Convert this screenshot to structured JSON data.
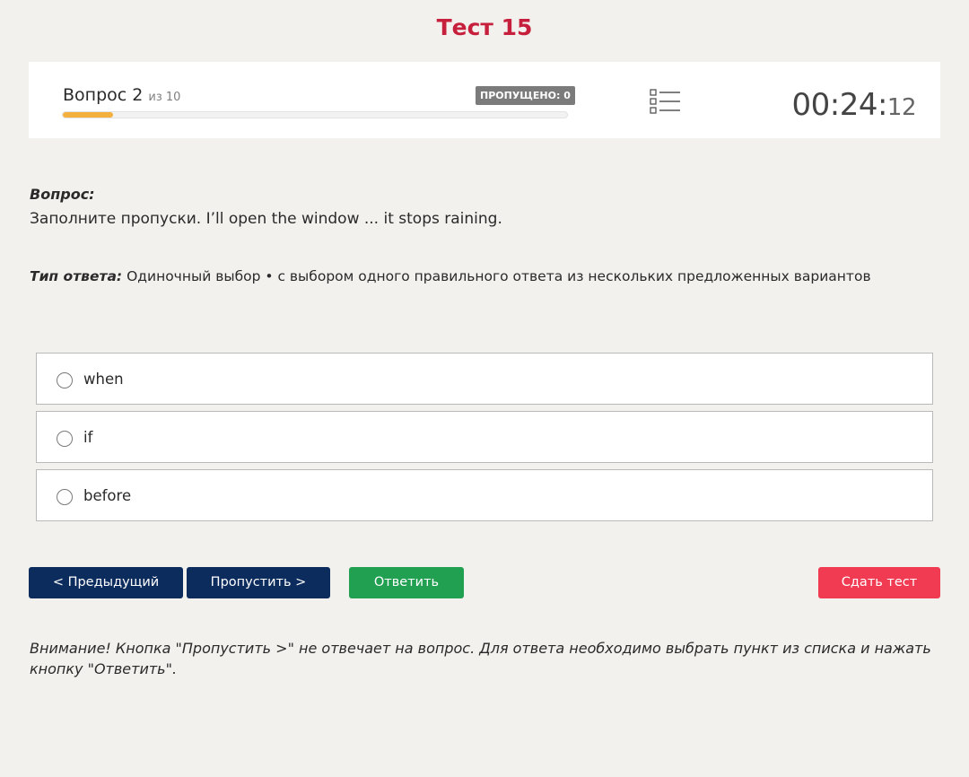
{
  "test": {
    "title": "Тест 15"
  },
  "header": {
    "question_label": "Вопрос 2",
    "question_of": "из 10",
    "skipped_badge": "ПРОПУЩЕНО: 0",
    "progress_fraction": 0.1,
    "progress_color": "#f3b03f",
    "timer_main": "00:24:",
    "timer_seconds": "12",
    "list_icon": "question-list-icon"
  },
  "question": {
    "label": "Вопрос:",
    "text": "Заполните пропуски. I’ll open the window ... it stops raining."
  },
  "answer_type": {
    "label": "Тип ответа:",
    "value": "Одиночный выбор • с выбором одного правильного ответа из нескольких предложенных вариантов"
  },
  "options": [
    {
      "label": "when"
    },
    {
      "label": "if"
    },
    {
      "label": "before"
    }
  ],
  "buttons": {
    "prev": "< Предыдущий",
    "skip": "Пропустить >",
    "answer": "Ответить",
    "finish": "Сдать тест"
  },
  "colors": {
    "title": "#c7203c",
    "nav_button": "#0c2c5e",
    "answer_button": "#21a052",
    "finish_button": "#f03b52",
    "badge": "#7b7b7b"
  },
  "warning": "Внимание! Кнопка \"Пропустить >\" не отвечает на вопрос. Для ответа необходимо выбрать пункт из списка и нажать кнопку \"Ответить\"."
}
